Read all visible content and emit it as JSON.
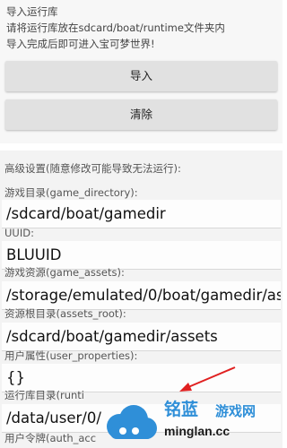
{
  "header": {
    "title": "导入运行库",
    "line1": "请将运行库放在sdcard/boat/runtime文件夹内",
    "line2": "导入完成后即可进入宝可梦世界!"
  },
  "buttons": {
    "import_label": "导入",
    "clear_label": "清除"
  },
  "settings": {
    "heading": "高级设置(随意修改可能导致无法运行):",
    "fields": [
      {
        "label": "游戏目录(game_directory):",
        "value": "/sdcard/boat/gamedir"
      },
      {
        "label": "UUID:",
        "value": "BLUUID"
      },
      {
        "label": "游戏资源(game_assets):",
        "value": "/storage/emulated/0/boat/gamedir/ass"
      },
      {
        "label": "资源根目录(assets_root):",
        "value": "/sdcard/boat/gamedir/assets"
      },
      {
        "label": "用户属性(user_properties):",
        "value": "{}"
      },
      {
        "label": "运行库目录(runti",
        "value": "/data/user/0/"
      },
      {
        "label": "用户令牌(auth_acc",
        "value": ""
      }
    ]
  },
  "watermark": {
    "brand_cn": "铭蓝",
    "site_cn": "游戏网",
    "url": "minglan.cc"
  },
  "colors": {
    "top_background": "#f7f7f7",
    "button_background": "#e1e1e1",
    "settings_background": "#f3f3f3",
    "arrow": "#e02020",
    "watermark_blue": "#2f8fd8"
  }
}
